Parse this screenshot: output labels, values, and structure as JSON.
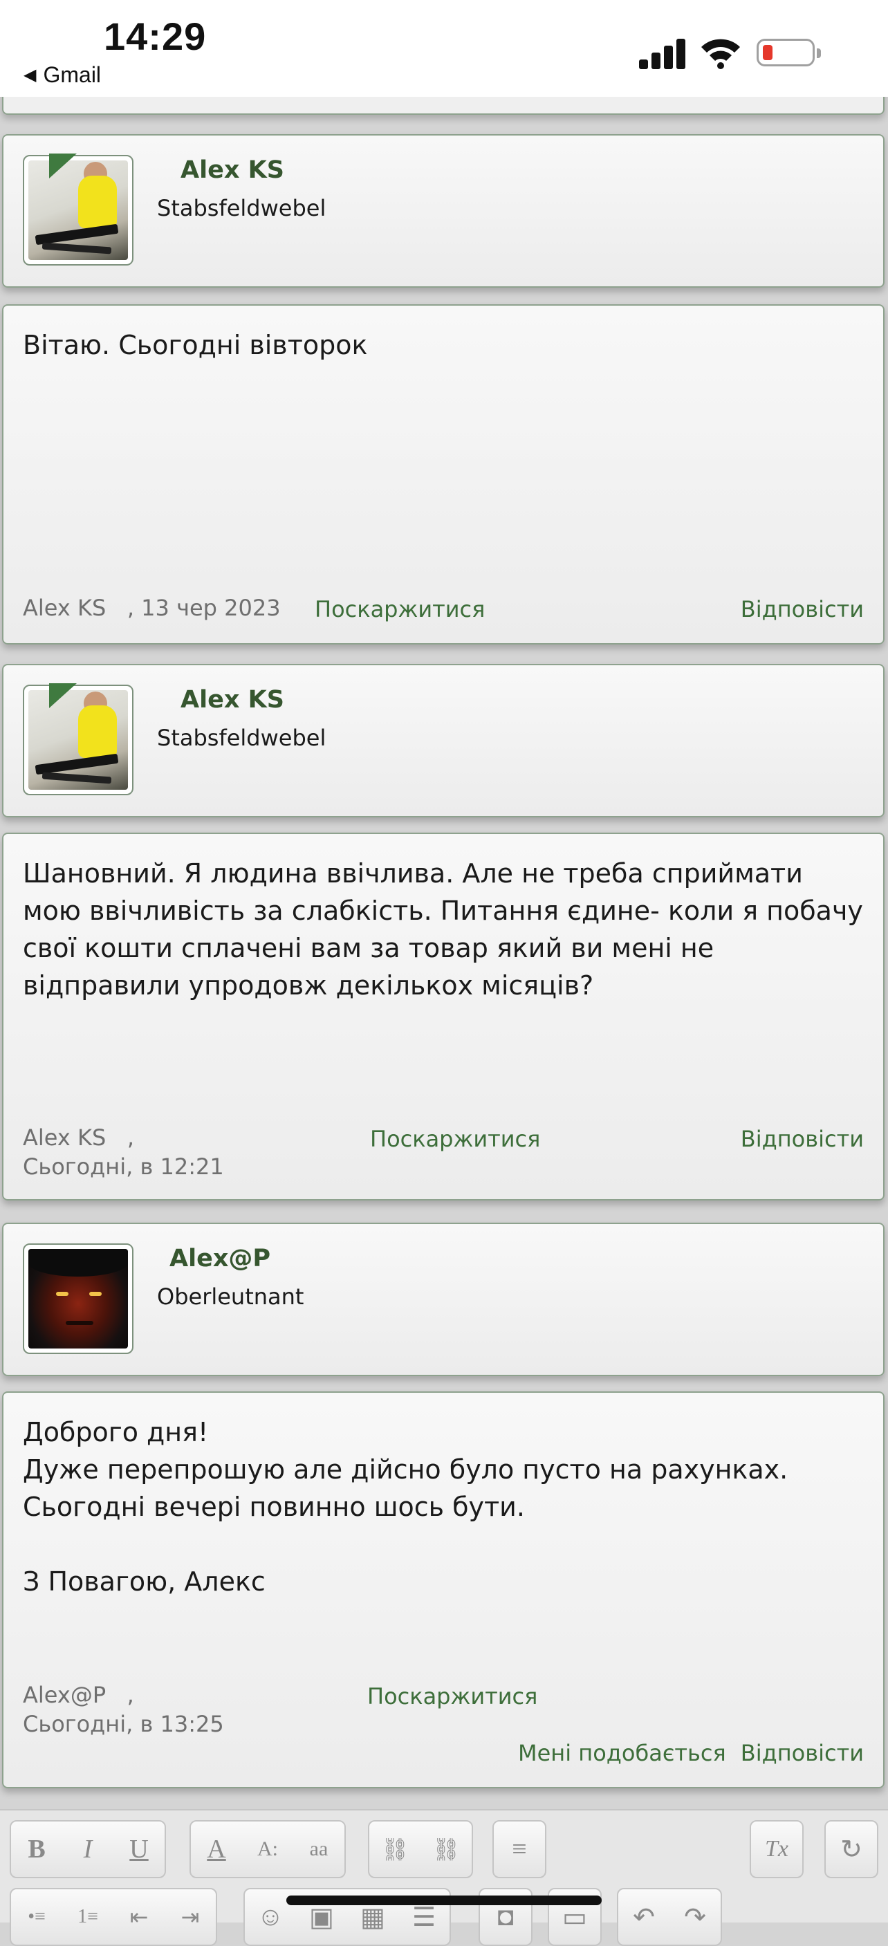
{
  "status_bar": {
    "time": "14:29",
    "back_label": "Gmail",
    "back_icon": "back-triangle-icon",
    "battery_color": "#e5372b"
  },
  "theme": {
    "accent_green": "#36562f",
    "link_green": "#3d6e3a"
  },
  "posts": [
    {
      "author": {
        "name": "Alex KS",
        "rank": "Stabsfeldwebel",
        "avatar": "child-with-rifles-photo"
      },
      "message": [
        "Вітаю. Сьогодні вівторок"
      ],
      "meta_author": "Alex KS",
      "meta_date": ", 13 чер 2023",
      "report_label": "Поскаржитися",
      "reply_label": "Відповісти"
    },
    {
      "author": {
        "name": "Alex KS",
        "rank": "Stabsfeldwebel",
        "avatar": "child-with-rifles-photo"
      },
      "message": [
        "Шановний. Я людина ввічлива. Але не треба сприймати мою ввічливість за слабкість. Питання єдине- коли я побачу свої кошти сплачені вам за товар який ви мені не відправили упродовж декількох місяців?"
      ],
      "meta_author": "Alex KS",
      "meta_sep": ",",
      "meta_date": "Сьогодні, в 12:21",
      "report_label": "Поскаржитися",
      "reply_label": "Відповісти"
    },
    {
      "author": {
        "name": "Alex@P",
        "rank": "Oberleutnant",
        "avatar": "sith-face-photo"
      },
      "message": [
        "Доброго дня!",
        "Дуже перепрошую але дійсно було пусто на рахунках.",
        "Сьогодні вечері повинно шось бути.",
        "",
        "З Повагою, Алекс"
      ],
      "meta_author": "Alex@P",
      "meta_sep": ",",
      "meta_date": "Сьогодні, в 13:25",
      "report_label": "Поскаржитися",
      "like_label": "Мені подобається",
      "reply_label": "Відповісти"
    }
  ],
  "editor_toolbar": {
    "row1": [
      {
        "icon": "bold-icon",
        "glyph": "B"
      },
      {
        "icon": "italic-icon",
        "glyph": "I"
      },
      {
        "icon": "underline-icon",
        "glyph": "U"
      },
      {
        "icon": "text-color-icon",
        "glyph": "A"
      },
      {
        "icon": "font-size-icon",
        "glyph": "A:"
      },
      {
        "icon": "font-family-icon",
        "glyph": "aa"
      },
      {
        "icon": "link-icon",
        "glyph": "⛓"
      },
      {
        "icon": "unlink-icon",
        "glyph": "⛓"
      },
      {
        "icon": "align-icon",
        "glyph": "≡"
      },
      {
        "icon": "remove-format-icon",
        "glyph": "Tx"
      },
      {
        "icon": "toggle-source-icon",
        "glyph": "↻"
      }
    ],
    "row2": [
      {
        "icon": "bullet-list-icon",
        "glyph": "•≡"
      },
      {
        "icon": "numbered-list-icon",
        "glyph": "1≡"
      },
      {
        "icon": "outdent-icon",
        "glyph": "⇤"
      },
      {
        "icon": "indent-icon",
        "glyph": "⇥"
      },
      {
        "icon": "smilie-icon",
        "glyph": "☺"
      },
      {
        "icon": "image-icon",
        "glyph": "▣"
      },
      {
        "icon": "media-icon",
        "glyph": "▦"
      },
      {
        "icon": "quote-icon",
        "glyph": "☰"
      },
      {
        "icon": "camera-icon",
        "glyph": "◘"
      },
      {
        "icon": "save-draft-icon",
        "glyph": "▭"
      },
      {
        "icon": "undo-icon",
        "glyph": "↶"
      },
      {
        "icon": "redo-icon",
        "glyph": "↷"
      }
    ]
  }
}
